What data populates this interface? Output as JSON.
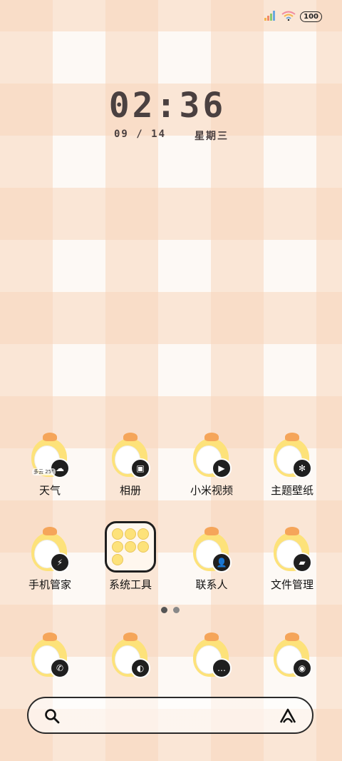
{
  "status_bar": {
    "battery": "100"
  },
  "clock": {
    "time": "02:36",
    "date": "09 / 14",
    "weekday": "星期三"
  },
  "apps_row1": [
    {
      "label": "天气",
      "icon": "weather-icon",
      "glyph": "☁",
      "mini": "多云 25°"
    },
    {
      "label": "相册",
      "icon": "gallery-icon",
      "glyph": "▣"
    },
    {
      "label": "小米视频",
      "icon": "video-icon",
      "glyph": "▶"
    },
    {
      "label": "主题壁纸",
      "icon": "theme-icon",
      "glyph": "✻"
    }
  ],
  "apps_row2": [
    {
      "label": "手机管家",
      "icon": "security-icon",
      "glyph": "⚡"
    },
    {
      "label": "系统工具",
      "icon": "folder-icon"
    },
    {
      "label": "联系人",
      "icon": "contacts-icon",
      "glyph": "👤"
    },
    {
      "label": "文件管理",
      "icon": "files-icon",
      "glyph": "▰"
    }
  ],
  "dock": [
    {
      "icon": "phone-icon",
      "glyph": "✆"
    },
    {
      "icon": "browser-icon",
      "glyph": "◐"
    },
    {
      "icon": "messages-icon",
      "glyph": "…"
    },
    {
      "icon": "camera-icon",
      "glyph": "◉"
    }
  ],
  "page_indicator": {
    "pages": 2,
    "current": 1
  },
  "search_bar": {
    "left_icon": "search-icon",
    "right_icon": "assistant-icon"
  }
}
